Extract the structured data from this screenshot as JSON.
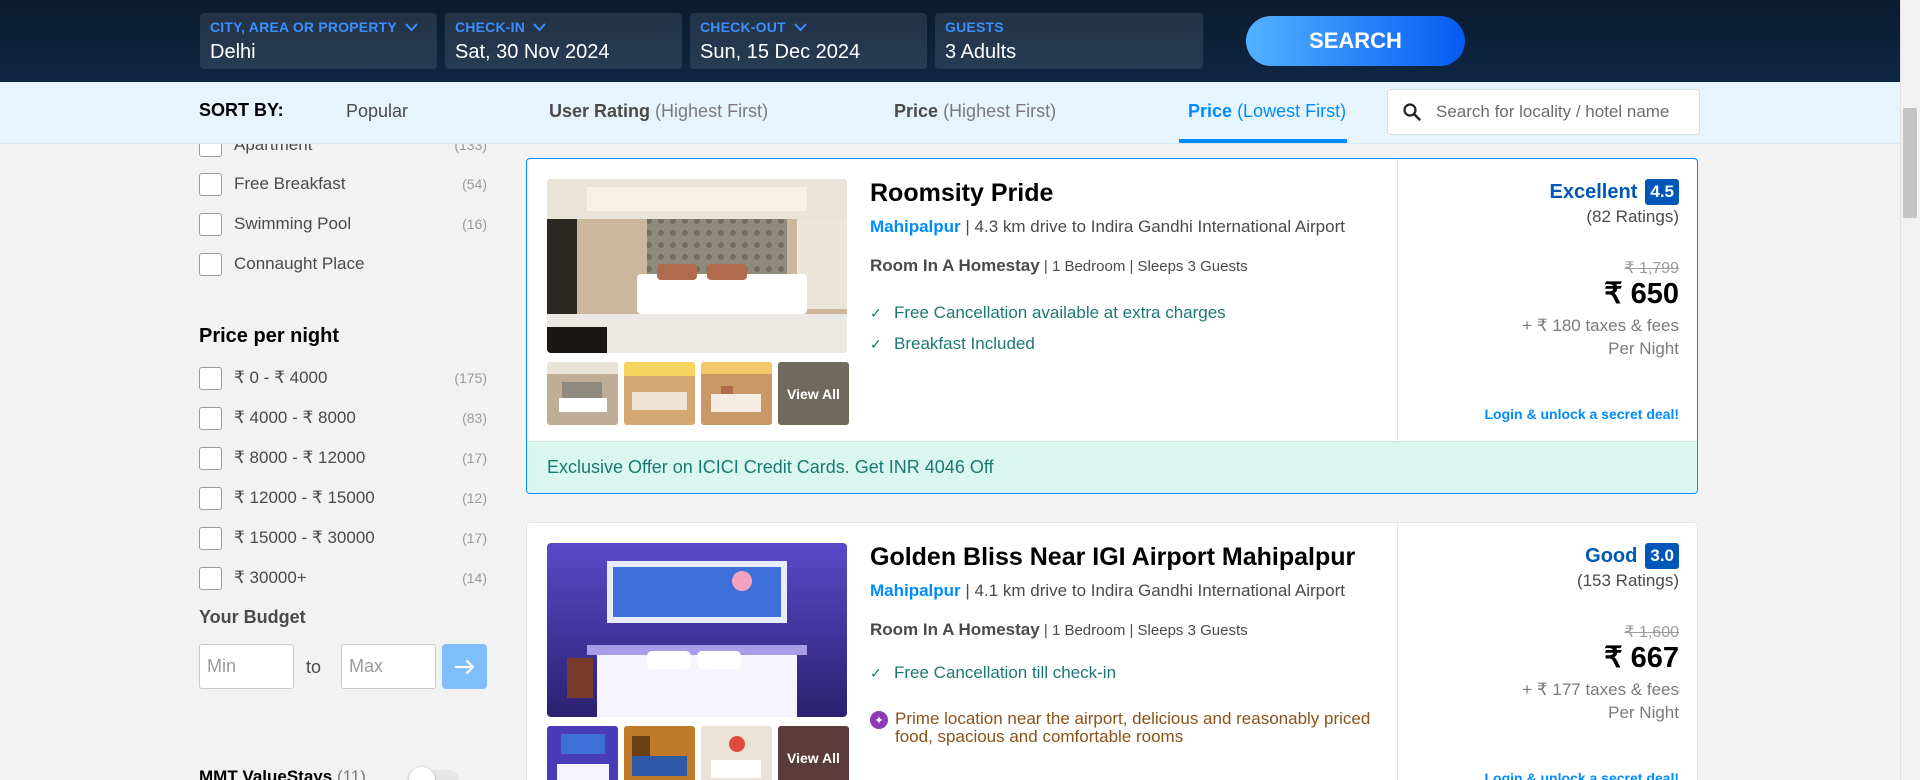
{
  "search": {
    "city": {
      "label": "CITY, AREA OR PROPERTY",
      "value": "Delhi"
    },
    "checkin": {
      "label": "CHECK-IN",
      "value": "Sat, 30 Nov 2024"
    },
    "checkout": {
      "label": "CHECK-OUT",
      "value": "Sun, 15 Dec 2024"
    },
    "guests": {
      "label": "GUESTS",
      "value": "3 Adults"
    },
    "button": "SEARCH"
  },
  "sort": {
    "label": "SORT BY:",
    "options": [
      {
        "main": "Popular",
        "sub": ""
      },
      {
        "main": "User Rating",
        "sub": "(Highest First)"
      },
      {
        "main": "Price",
        "sub": "(Highest First)"
      },
      {
        "main": "Price",
        "sub": "(Lowest First)"
      }
    ],
    "active_index": 3,
    "locality_placeholder": "Search for locality / hotel name"
  },
  "filters": {
    "amenities": [
      {
        "label": "Apartment",
        "count": "(133)"
      },
      {
        "label": "Free Breakfast",
        "count": "(54)"
      },
      {
        "label": "Swimming Pool",
        "count": "(16)"
      },
      {
        "label": "Connaught Place",
        "count": ""
      }
    ],
    "price_title": "Price per night",
    "price_ranges": [
      {
        "label": "₹ 0 - ₹ 4000",
        "count": "(175)"
      },
      {
        "label": "₹ 4000 - ₹ 8000",
        "count": "(83)"
      },
      {
        "label": "₹ 8000 - ₹ 12000",
        "count": "(17)"
      },
      {
        "label": "₹ 12000 - ₹ 15000",
        "count": "(12)"
      },
      {
        "label": "₹ 15000 - ₹ 30000",
        "count": "(17)"
      },
      {
        "label": "₹ 30000+",
        "count": "(14)"
      }
    ],
    "budget": {
      "title": "Your Budget",
      "min_placeholder": "Min",
      "to": "to",
      "max_placeholder": "Max"
    },
    "mmt_valuestays": {
      "label": "MMT ValueStays",
      "count": "(11)"
    }
  },
  "hotels": [
    {
      "name": "Roomsity Pride",
      "area": "Mahipalpur",
      "distance": " | 4.3 km drive to Indira Gandhi International Airport",
      "room_type": "Room In A Homestay",
      "room_details": " | 1 Bedroom | Sleeps 3 Guests",
      "perks": [
        "Free Cancellation available at extra charges",
        "Breakfast Included"
      ],
      "usp": "",
      "view_all": "View All",
      "rating_word": "Excellent",
      "rating": "4.5",
      "rating_count": "(82 Ratings)",
      "old_price": "₹ 1,799",
      "price": "₹ 650",
      "taxes": "+ ₹ 180 taxes & fees",
      "per_night": "Per Night",
      "secret_deal": "Login & unlock a secret deal!",
      "offer": "Exclusive Offer on ICICI Credit Cards. Get INR 4046 Off"
    },
    {
      "name": "Golden Bliss Near IGI Airport Mahipalpur",
      "area": "Mahipalpur",
      "distance": " | 4.1 km drive to Indira Gandhi International Airport",
      "room_type": "Room In A Homestay",
      "room_details": " | 1 Bedroom | Sleeps 3 Guests",
      "perks": [
        "Free Cancellation till check-in"
      ],
      "usp": "Prime location near the airport, delicious and reasonably priced food, spacious and comfortable rooms",
      "view_all": "View All",
      "rating_word": "Good",
      "rating": "3.0",
      "rating_count": "(153 Ratings)",
      "old_price": "₹ 1,600",
      "price": "₹ 667",
      "taxes": "+ ₹ 177 taxes & fees",
      "per_night": "Per Night",
      "secret_deal": "Login & unlock a secret deal!",
      "offer": ""
    }
  ],
  "colors": {
    "brand_blue": "#008cff",
    "rating_blue": "#0057b8",
    "perk_green": "#1a7971",
    "offer_bg": "#d9f7ee",
    "header_navy": "#0f2744"
  }
}
